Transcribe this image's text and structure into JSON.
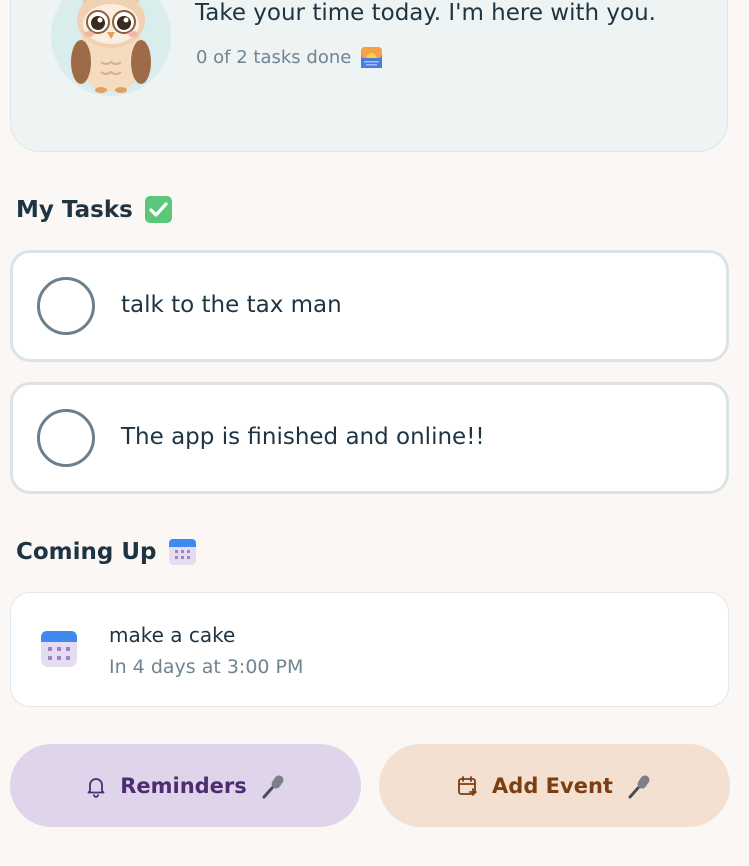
{
  "header": {
    "greeting": "Take your time today. I'm here with you.",
    "progress_text": "0 of 2 tasks done",
    "progress_icon": "sunrise-icon",
    "avatar_icon": "owl-icon"
  },
  "tasks_section": {
    "title": "My Tasks",
    "icon": "check-mark-icon",
    "items": [
      {
        "label": "talk to the tax man",
        "done": false
      },
      {
        "label": "The app is finished and online!!",
        "done": false
      }
    ]
  },
  "upcoming_section": {
    "title": "Coming Up",
    "icon": "calendar-icon",
    "events": [
      {
        "title": "make a cake",
        "when": "In 4 days at 3:00 PM",
        "icon": "calendar-icon"
      }
    ]
  },
  "actions": {
    "reminders_label": "Reminders",
    "reminders_icon": "bell-icon",
    "add_event_label": "Add Event",
    "add_event_icon": "calendar-plus-icon",
    "voice_icon": "microphone-icon"
  },
  "colors": {
    "background": "#faf7f4",
    "reminders_bg": "#e0d4ea",
    "reminders_text": "#4c2d71",
    "add_event_bg": "#f4e0d0",
    "add_event_text": "#7a3f12",
    "text_primary": "#1f3442",
    "text_muted": "#6f8592"
  }
}
